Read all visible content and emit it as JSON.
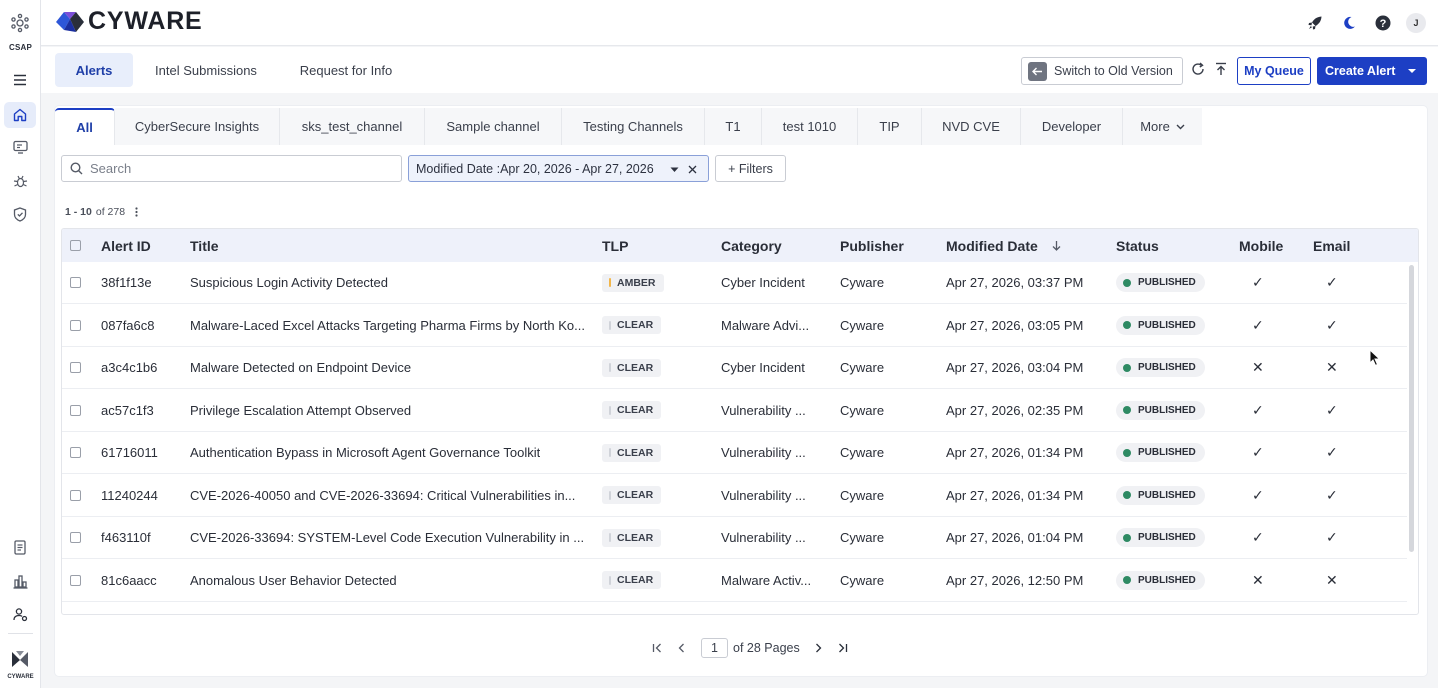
{
  "app": {
    "brand": "CYWARE",
    "rail_label": "CSAP",
    "rail_footer": "CYWARE",
    "avatar_initial": "J",
    "accent": "#1d3fc4"
  },
  "subnav": {
    "tabs": [
      {
        "label": "Alerts"
      },
      {
        "label": "Intel Submissions"
      },
      {
        "label": "Request for Info"
      }
    ],
    "switch_label": "Switch to Old Version",
    "my_queue_label": "My Queue",
    "create_label": "Create Alert"
  },
  "channels": {
    "tabs": [
      {
        "label": "All"
      },
      {
        "label": "CyberSecure Insights"
      },
      {
        "label": "sks_test_channel"
      },
      {
        "label": "Sample channel"
      },
      {
        "label": "Testing Channels"
      },
      {
        "label": "T1"
      },
      {
        "label": "test 1010"
      },
      {
        "label": "TIP"
      },
      {
        "label": "NVD CVE"
      },
      {
        "label": "Developer"
      }
    ],
    "more_label": "More"
  },
  "filters": {
    "search_placeholder": "Search",
    "date_chip": "Modified Date :Apr 20, 2026 - Apr 27, 2026",
    "filters_label": "+ Filters"
  },
  "count": {
    "range": "1 - 10",
    "total": "of 278"
  },
  "table": {
    "columns": [
      "Alert ID",
      "Title",
      "TLP",
      "Category",
      "Publisher",
      "Modified Date",
      "Status",
      "Mobile",
      "Email"
    ],
    "rows": [
      {
        "id": "38f1f13e",
        "title": "Suspicious Login Activity Detected",
        "tlp": "AMBER",
        "category": "Cyber Incident",
        "publisher": "Cyware",
        "modified": "Apr 27, 2026, 03:37 PM",
        "status": "PUBLISHED",
        "mobile": "✓",
        "email": "✓"
      },
      {
        "id": "087fa6c8",
        "title": "Malware-Laced Excel Attacks Targeting Pharma Firms by North Ko...",
        "tlp": "CLEAR",
        "category": "Malware Advi...",
        "publisher": "Cyware",
        "modified": "Apr 27, 2026, 03:05 PM",
        "status": "PUBLISHED",
        "mobile": "✓",
        "email": "✓"
      },
      {
        "id": "a3c4c1b6",
        "title": "Malware Detected on Endpoint Device",
        "tlp": "CLEAR",
        "category": "Cyber Incident",
        "publisher": "Cyware",
        "modified": "Apr 27, 2026, 03:04 PM",
        "status": "PUBLISHED",
        "mobile": "✕",
        "email": "✕"
      },
      {
        "id": "ac57c1f3",
        "title": "Privilege Escalation Attempt Observed",
        "tlp": "CLEAR",
        "category": "Vulnerability ...",
        "publisher": "Cyware",
        "modified": "Apr 27, 2026, 02:35 PM",
        "status": "PUBLISHED",
        "mobile": "✓",
        "email": "✓"
      },
      {
        "id": "61716011",
        "title": "Authentication Bypass in Microsoft Agent Governance Toolkit",
        "tlp": "CLEAR",
        "category": "Vulnerability ...",
        "publisher": "Cyware",
        "modified": "Apr 27, 2026, 01:34 PM",
        "status": "PUBLISHED",
        "mobile": "✓",
        "email": "✓"
      },
      {
        "id": "11240244",
        "title": "CVE-2026-40050 and CVE-2026-33694: Critical Vulnerabilities in...",
        "tlp": "CLEAR",
        "category": "Vulnerability ...",
        "publisher": "Cyware",
        "modified": "Apr 27, 2026, 01:34 PM",
        "status": "PUBLISHED",
        "mobile": "✓",
        "email": "✓"
      },
      {
        "id": "f463110f",
        "title": "CVE-2026-33694: SYSTEM-Level Code Execution Vulnerability in ...",
        "tlp": "CLEAR",
        "category": "Vulnerability ...",
        "publisher": "Cyware",
        "modified": "Apr 27, 2026, 01:04 PM",
        "status": "PUBLISHED",
        "mobile": "✓",
        "email": "✓"
      },
      {
        "id": "81c6aacc",
        "title": "Anomalous User Behavior Detected",
        "tlp": "CLEAR",
        "category": "Malware Activ...",
        "publisher": "Cyware",
        "modified": "Apr 27, 2026, 12:50 PM",
        "status": "PUBLISHED",
        "mobile": "✕",
        "email": "✕"
      }
    ],
    "colors": {
      "amber": "#f2b64a",
      "clear": "#d0d3d9",
      "published": "#2e8a63"
    }
  },
  "pagination": {
    "page": "1",
    "of_pages": "of 28 Pages"
  }
}
